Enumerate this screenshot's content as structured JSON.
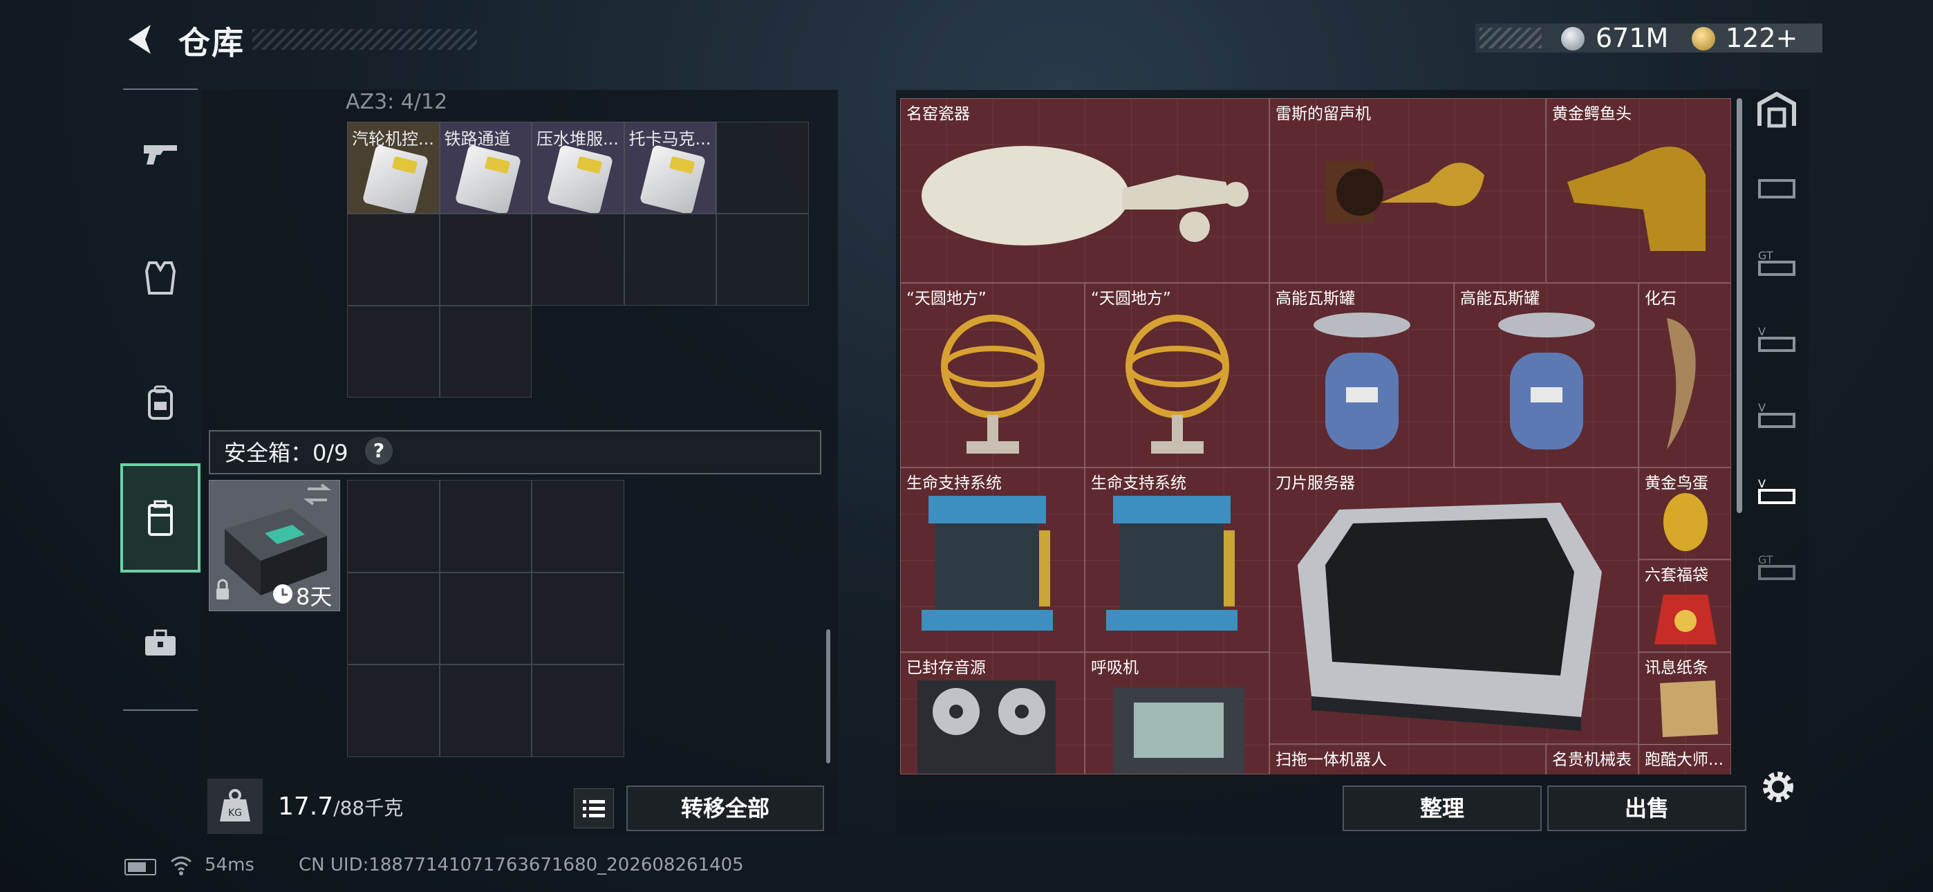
{
  "header": {
    "title": "仓库",
    "currency_silver": "671M",
    "currency_gold": "122+"
  },
  "left_nav": {
    "items": [
      "gun-icon",
      "vest-icon",
      "backpack-icon",
      "safe-case-icon",
      "toolbox-icon"
    ],
    "active_index": 3
  },
  "container": {
    "label": "AZ3: 4/12",
    "items": [
      "汽轮机控...",
      "铁路通道",
      "压水堆服...",
      "托卡马克..."
    ]
  },
  "safe_box": {
    "label": "安全箱：0/9",
    "help": "?",
    "days": "8天"
  },
  "footer_left": {
    "weight_value": "17.7",
    "weight_unit": "/88千克",
    "transfer_label": "转移全部"
  },
  "stash": {
    "items": [
      {
        "name": "名窑瓷器"
      },
      {
        "name": "雷斯的留声机"
      },
      {
        "name": "黄金鳄鱼头"
      },
      {
        "name": "“天圆地方”"
      },
      {
        "name": "“天圆地方”"
      },
      {
        "name": "高能瓦斯罐"
      },
      {
        "name": "高能瓦斯罐"
      },
      {
        "name": "化石"
      },
      {
        "name": "生命支持系统"
      },
      {
        "name": "生命支持系统"
      },
      {
        "name": "刀片服务器"
      },
      {
        "name": "黄金鸟蛋"
      },
      {
        "name": "六套福袋"
      },
      {
        "name": "已封存音源"
      },
      {
        "name": "呼吸机"
      },
      {
        "name": "讯息纸条"
      },
      {
        "name": "扫拖一体机器人"
      },
      {
        "name": "名贵机械表"
      },
      {
        "name": "跑酷大师..."
      }
    ]
  },
  "footer_right": {
    "sort_label": "整理",
    "sell_label": "出售"
  },
  "status": {
    "ping": "54ms",
    "uid": "CN UID:1887714107176367168​0_202608261405"
  },
  "colors": {
    "stash_bg": "#5e2a2f",
    "accent_green": "#6ad2a6"
  }
}
